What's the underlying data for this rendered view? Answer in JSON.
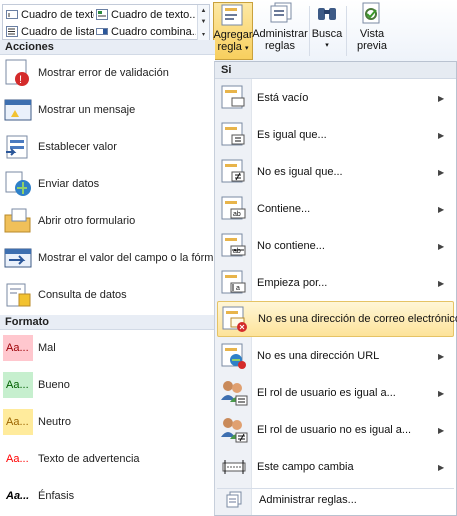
{
  "ribbon": {
    "gallery": [
      {
        "label": "Cuadro de texto..."
      },
      {
        "label": "Cuadro de texto..."
      },
      {
        "label": "Cuadro de lista ..."
      },
      {
        "label": "Cuadro combina..."
      }
    ],
    "buttons": {
      "agregar_regla": {
        "line1": "Agregar",
        "line2": "regla",
        "caret": "▾"
      },
      "administrar_reglas": {
        "line1": "Administrar",
        "line2": "reglas"
      },
      "busca": {
        "line1": "Busca",
        "caret": "▾"
      },
      "vista_previa": {
        "line1": "Vista",
        "line2": "previa"
      }
    }
  },
  "left": {
    "acciones_header": "Acciones",
    "actions": [
      {
        "label": "Mostrar error de validación",
        "icon": "validation-error-icon"
      },
      {
        "label": "Mostrar un mensaje",
        "icon": "message-icon"
      },
      {
        "label": "Establecer valor",
        "icon": "set-value-icon"
      },
      {
        "label": "Enviar datos",
        "icon": "submit-data-icon"
      },
      {
        "label": "Abrir otro formulario",
        "icon": "open-form-icon"
      },
      {
        "label": "Mostrar el valor del campo o la fórmula",
        "icon": "show-field-value-icon"
      },
      {
        "label": "Consulta de datos",
        "icon": "query-data-icon"
      }
    ],
    "formato_header": "Formato",
    "formats": [
      {
        "label": "Mal",
        "swatch": "Aa...",
        "bg": "#ffc7ce",
        "fg": "#9c0006"
      },
      {
        "label": "Bueno",
        "swatch": "Aa...",
        "bg": "#c6efce",
        "fg": "#006100"
      },
      {
        "label": "Neutro",
        "swatch": "Aa...",
        "bg": "#ffeb9c",
        "fg": "#9c6500"
      },
      {
        "label": "Texto de advertencia",
        "swatch": "Aa...",
        "bg": "#ffffff",
        "fg": "#ff0000"
      },
      {
        "label": "Énfasis",
        "swatch": "Aa...",
        "bg": "#ffffff",
        "fg": "#000000"
      }
    ]
  },
  "menu": {
    "header": "Si",
    "items": [
      {
        "label": "Está vacío",
        "icon": "is-empty-icon"
      },
      {
        "label": "Es igual que...",
        "icon": "equals-icon"
      },
      {
        "label": "No es igual que...",
        "icon": "not-equal-icon"
      },
      {
        "label": "Contiene...",
        "icon": "contains-icon"
      },
      {
        "label": "No contiene...",
        "icon": "not-contains-icon"
      },
      {
        "label": "Empieza por...",
        "icon": "starts-with-icon"
      },
      {
        "label": "No es una dirección de correo electrónico",
        "icon": "not-email-icon"
      },
      {
        "label": "No es una dirección URL",
        "icon": "not-url-icon"
      },
      {
        "label": "El rol de usuario es igual a...",
        "icon": "user-role-equals-icon"
      },
      {
        "label": "El rol de usuario no es igual a...",
        "icon": "user-role-not-equal-icon"
      },
      {
        "label": "Este campo cambia",
        "icon": "field-changes-icon"
      }
    ],
    "manage": "Administrar reglas..."
  },
  "colors": {
    "highlight": "#fde39a",
    "accent": "#2b579a"
  }
}
